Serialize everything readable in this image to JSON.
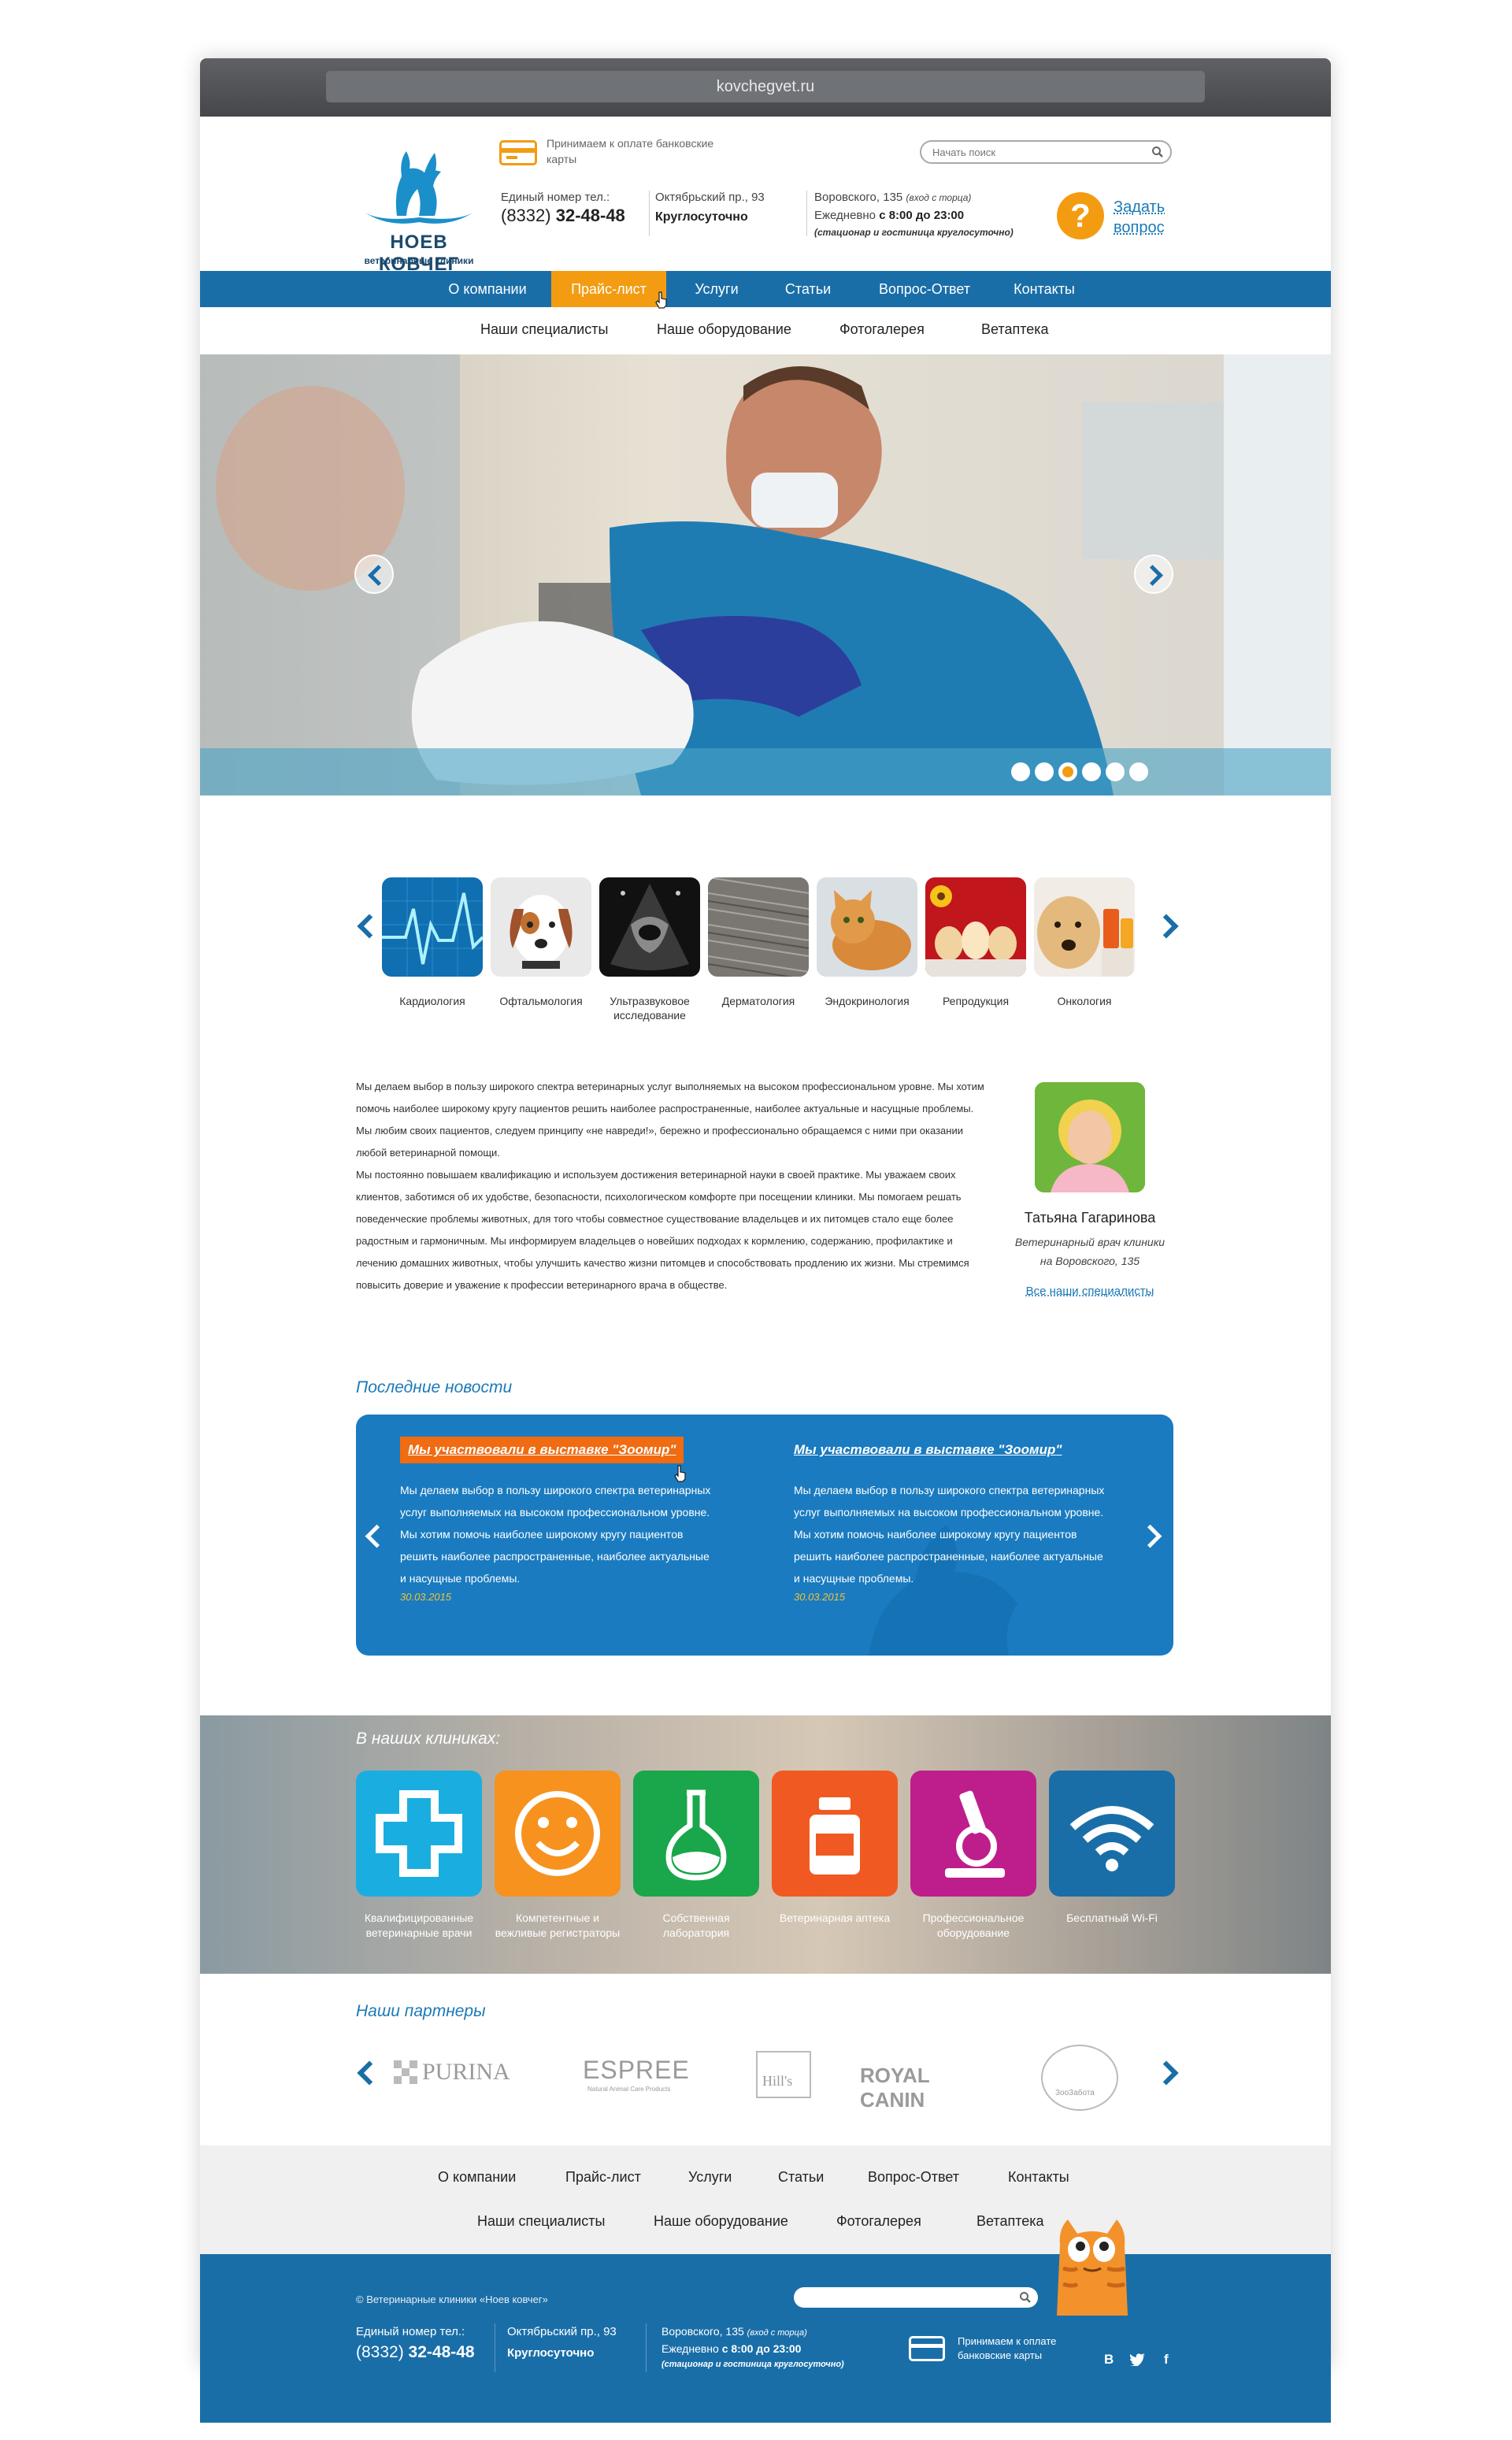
{
  "browser": {
    "url": "kovchegvet.ru"
  },
  "header": {
    "logo_title": "НОЕВ КОВЧЕГ",
    "logo_subtitle": "ветеринарные клиники",
    "payment_text": "Принимаем к оплате банковские карты",
    "search_placeholder": "Начать поиск",
    "phone_label": "Единый номер тел.:",
    "phone_code": "(8332)",
    "phone_number": "32-48-48",
    "address1": "Октябрьский пр., 93",
    "hours1": "Круглосуточно",
    "address2": "Воровского, 135",
    "address2_note": "(вход с торца)",
    "hours2_prefix": "Ежедневно",
    "hours2_time": "с 8:00 до 23:00",
    "hours2_note": "(стационар и гостиница круглосуточно)",
    "ask_icon": "?",
    "ask_line1": "Задать",
    "ask_line2": "вопрос"
  },
  "nav": {
    "items": [
      "О компании",
      "Прайс-лист",
      "Услуги",
      "Статьи",
      "Вопрос-Ответ",
      "Контакты"
    ],
    "active": "Прайс-лист",
    "subitems": [
      "Наши специалисты",
      "Наше оборудование",
      "Фотогалерея",
      "Ветаптека"
    ]
  },
  "slider": {
    "slide_count": 6,
    "active_slide": 3
  },
  "services": [
    {
      "label": "Кардиология",
      "icon": "cardio-icon"
    },
    {
      "label": "Офтальмология",
      "icon": "dog-icon"
    },
    {
      "label": "Ультразвуковое исследование",
      "icon": "ultrasound-icon"
    },
    {
      "label": "Дерматология",
      "icon": "fur-icon"
    },
    {
      "label": "Эндокринология",
      "icon": "cat-icon"
    },
    {
      "label": "Репродукция",
      "icon": "puppies-icon"
    },
    {
      "label": "Онкология",
      "icon": "labrador-icon"
    }
  ],
  "about": {
    "p1": "Мы делаем выбор в пользу широкого спектра ветеринарных услуг выполняемых на высоком профессиональном уровне. Мы хотим помочь наиболее широкому кругу пациентов решить наиболее распространенные, наиболее актуальные и насущные проблемы. Мы любим своих пациентов, следуем принципу «не навреди!», бережно и профессионально обращаемся с ними при оказании любой ветеринарной помощи.",
    "p2": "Мы постоянно повышаем квалификацию и используем достижения ветеринарной науки в своей практике. Мы уважаем своих клиентов, заботимся об их удобстве, безопасности, психологическом комфорте при посещении клиники. Мы помогаем решать поведенческие проблемы животных, для того чтобы совместное существование владельцев и их питомцев стало еще более радостным и гармоничным. Мы информируем владельцев о новейших подходах к кормлению, содержанию, профилактике и лечению домашних животных, чтобы улучшить качество жизни питомцев и способствовать продлению их жизни. Мы стремимся повысить доверие и уважение к профессии ветеринарного врача в обществе."
  },
  "doctor": {
    "name": "Татьяна Гагаринова",
    "role": "Ветеринарный врач клиники на Воровского, 135",
    "link": "Все наши специалисты"
  },
  "news": {
    "title": "Последние новости",
    "items": [
      {
        "headline": "Мы участвовали в выставке \"Зоомир\"",
        "text": "Мы делаем выбор в пользу широкого спектра ветеринарных услуг выполняемых на высоком профессиональном уровне. Мы хотим помочь наиболее широкому кругу пациентов решить наиболее распространенные, наиболее актуальные и насущные проблемы.",
        "date": "30.03.2015"
      },
      {
        "headline": "Мы участвовали в выставке \"Зоомир\"",
        "text": "Мы делаем выбор в пользу широкого спектра ветеринарных услуг выполняемых на высоком профессиональном уровне. Мы хотим помочь наиболее широкому кругу пациентов решить наиболее распространенные, наиболее актуальные и насущные проблемы.",
        "date": "30.03.2015"
      }
    ]
  },
  "features": {
    "title": "В наших клиниках:",
    "items": [
      {
        "label": "Квалифицированные ветеринарные врачи",
        "icon": "medical-cross-icon",
        "color": "#1aaee0"
      },
      {
        "label": "Компетентные и вежливые регистраторы",
        "icon": "smile-icon",
        "color": "#f7921e"
      },
      {
        "label": "Собственная лаборатория",
        "icon": "flask-icon",
        "color": "#1aa64a"
      },
      {
        "label": "Ветеринарная аптека",
        "icon": "medicine-jar-icon",
        "color": "#f05a22"
      },
      {
        "label": "Профессиональное оборудование",
        "icon": "microscope-icon",
        "color": "#be1e8c"
      },
      {
        "label": "Бесплатный Wi-Fi",
        "icon": "wifi-icon",
        "color": "#1a6ea8"
      }
    ]
  },
  "partners": {
    "title": "Наши партнеры",
    "items": [
      "PURINA",
      "ESPREE",
      "Natural Animal Care Products",
      "Hill's",
      "ROYAL CANIN",
      "ЗооЗабота"
    ]
  },
  "footer": {
    "copyright": "© Ветеринарные клиники «Ноев ковчег»",
    "phone_label": "Единый номер тел.:",
    "phone_code": "(8332)",
    "phone_number": "32-48-48",
    "address1": "Октябрьский пр., 93",
    "hours1": "Круглосуточно",
    "address2": "Воровского, 135",
    "address2_note": "(вход с торца)",
    "hours2_prefix": "Ежедневно",
    "hours2_time": "с 8:00 до 23:00",
    "hours2_note": "(стационар и гостиница круглосуточно)",
    "payment_text": "Принимаем к оплате банковские карты",
    "social": [
      "В",
      "twitter",
      "f"
    ]
  },
  "colors": {
    "brand_blue": "#1a6ea8",
    "accent_orange": "#f39c12",
    "link_blue": "#1b79b8"
  }
}
